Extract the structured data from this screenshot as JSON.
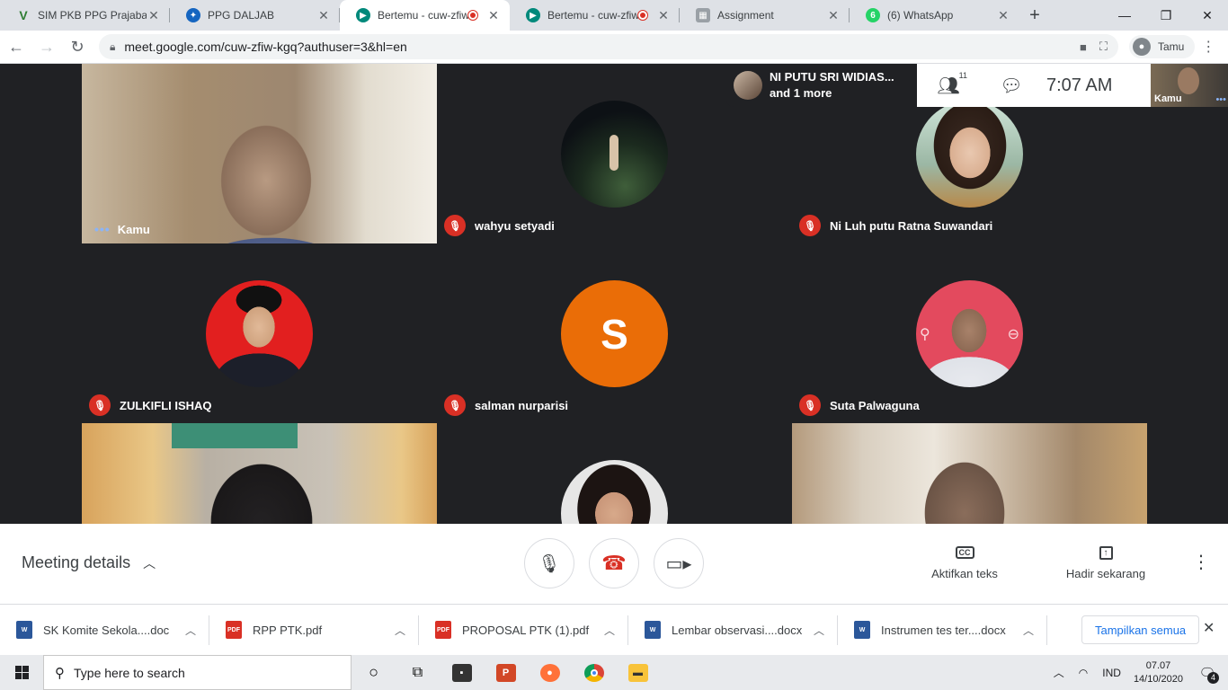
{
  "browser": {
    "tabs": [
      {
        "title": "SIM PKB PPG Prajabatan",
        "favicon": "v-logo-icon",
        "color": "#2e7d32",
        "recording": false
      },
      {
        "title": "PPG DALJAB",
        "favicon": "tut-wuri-icon",
        "color": "#1565c0",
        "recording": false
      },
      {
        "title": "Bertemu - cuw-zfiw",
        "favicon": "meet-icon",
        "color": "#00897b",
        "recording": true,
        "active": true
      },
      {
        "title": "Bertemu - cuw-zfiw",
        "favicon": "meet-icon",
        "color": "#00897b",
        "recording": true
      },
      {
        "title": "Assignment",
        "favicon": "assignment-icon",
        "color": "#5f6368",
        "recording": false
      },
      {
        "title": "(6) WhatsApp",
        "favicon": "whatsapp-icon",
        "color": "#25d366",
        "badge": "6",
        "recording": false
      }
    ],
    "url": "meet.google.com/cuw-zfiw-kgq?authuser=3&hl=en",
    "profile_label": "Tamu"
  },
  "meet": {
    "participants": [
      {
        "name": "Kamu",
        "type": "video",
        "muted": false,
        "self": true
      },
      {
        "name": "wahyu setyadi",
        "type": "avatar",
        "muted": true
      },
      {
        "name": "Ni Luh putu Ratna Suwandari",
        "type": "avatar",
        "muted": true
      },
      {
        "name": "ZULKIFLI ISHAQ",
        "type": "avatar",
        "muted": true
      },
      {
        "name": "salman nurparisi",
        "type": "letter",
        "letter": "S",
        "muted": true
      },
      {
        "name": "Suta Palwaguna",
        "type": "avatar",
        "muted": true
      },
      {
        "name": "",
        "type": "video",
        "muted": false
      },
      {
        "name": "",
        "type": "avatar",
        "muted": false
      },
      {
        "name": "",
        "type": "video",
        "muted": false
      }
    ],
    "speaking_name": "NI PUTU SRI WIDIAS...",
    "speaking_more": "and 1 more",
    "participant_count": "11",
    "clock": "7:07  AM",
    "self_label": "Kamu",
    "details_label": "Meeting details",
    "captions_label": "Aktifkan teks",
    "present_label": "Hadir sekarang"
  },
  "downloads": {
    "files": [
      {
        "name": "SK Komite Sekola....doc",
        "type": "W",
        "color": "#2b579a"
      },
      {
        "name": "RPP PTK.pdf",
        "type": "PDF",
        "color": "#d93025"
      },
      {
        "name": "PROPOSAL PTK (1).pdf",
        "type": "PDF",
        "color": "#d93025"
      },
      {
        "name": "Lembar observasi....docx",
        "type": "W",
        "color": "#2b579a"
      },
      {
        "name": "Instrumen tes ter....docx",
        "type": "W",
        "color": "#2b579a"
      }
    ],
    "show_all": "Tampilkan semua"
  },
  "taskbar": {
    "search_placeholder": "Type here to search",
    "language": "IND",
    "time": "07.07",
    "date": "14/10/2020",
    "notifications": "4"
  }
}
